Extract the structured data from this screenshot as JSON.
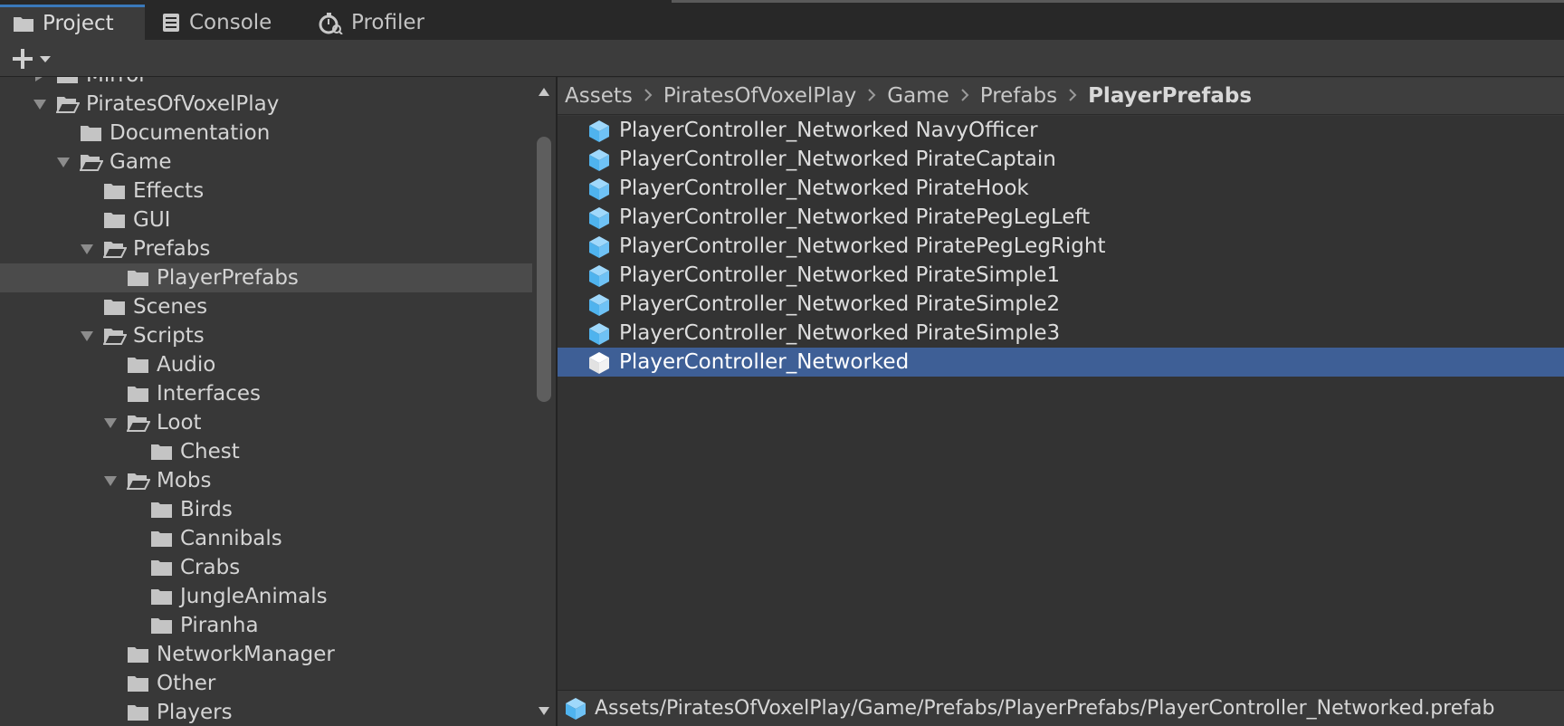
{
  "tabs": [
    {
      "label": "Project",
      "icon": "folder-icon",
      "active": true
    },
    {
      "label": "Console",
      "icon": "console-icon",
      "active": false
    },
    {
      "label": "Profiler",
      "icon": "profiler-icon",
      "active": false
    }
  ],
  "toolbar": {
    "create_icon": "plus-icon",
    "dropdown_icon": "chevron-down-icon"
  },
  "tree": [
    {
      "label": "Mirror",
      "depth": 1,
      "expanded": false,
      "has_children": true
    },
    {
      "label": "PiratesOfVoxelPlay",
      "depth": 1,
      "expanded": true,
      "has_children": true
    },
    {
      "label": "Documentation",
      "depth": 2,
      "expanded": false,
      "has_children": false
    },
    {
      "label": "Game",
      "depth": 2,
      "expanded": true,
      "has_children": true
    },
    {
      "label": "Effects",
      "depth": 3,
      "expanded": false,
      "has_children": false
    },
    {
      "label": "GUI",
      "depth": 3,
      "expanded": false,
      "has_children": false
    },
    {
      "label": "Prefabs",
      "depth": 3,
      "expanded": true,
      "has_children": true
    },
    {
      "label": "PlayerPrefabs",
      "depth": 4,
      "expanded": false,
      "has_children": false,
      "selected": true
    },
    {
      "label": "Scenes",
      "depth": 3,
      "expanded": false,
      "has_children": false
    },
    {
      "label": "Scripts",
      "depth": 3,
      "expanded": true,
      "has_children": true
    },
    {
      "label": "Audio",
      "depth": 4,
      "expanded": false,
      "has_children": false
    },
    {
      "label": "Interfaces",
      "depth": 4,
      "expanded": false,
      "has_children": false
    },
    {
      "label": "Loot",
      "depth": 4,
      "expanded": true,
      "has_children": true
    },
    {
      "label": "Chest",
      "depth": 5,
      "expanded": false,
      "has_children": false
    },
    {
      "label": "Mobs",
      "depth": 4,
      "expanded": true,
      "has_children": true
    },
    {
      "label": "Birds",
      "depth": 5,
      "expanded": false,
      "has_children": false
    },
    {
      "label": "Cannibals",
      "depth": 5,
      "expanded": false,
      "has_children": false
    },
    {
      "label": "Crabs",
      "depth": 5,
      "expanded": false,
      "has_children": false
    },
    {
      "label": "JungleAnimals",
      "depth": 5,
      "expanded": false,
      "has_children": false
    },
    {
      "label": "Piranha",
      "depth": 5,
      "expanded": false,
      "has_children": false
    },
    {
      "label": "NetworkManager",
      "depth": 4,
      "expanded": false,
      "has_children": false
    },
    {
      "label": "Other",
      "depth": 4,
      "expanded": false,
      "has_children": false
    },
    {
      "label": "Players",
      "depth": 4,
      "expanded": false,
      "has_children": false
    }
  ],
  "breadcrumb": [
    "Assets",
    "PiratesOfVoxelPlay",
    "Game",
    "Prefabs",
    "PlayerPrefabs"
  ],
  "files": [
    {
      "label": "PlayerController_Networked NavyOfficer",
      "icon": "prefab-variant-icon",
      "selected": false
    },
    {
      "label": "PlayerController_Networked PirateCaptain",
      "icon": "prefab-variant-icon",
      "selected": false
    },
    {
      "label": "PlayerController_Networked PirateHook",
      "icon": "prefab-variant-icon",
      "selected": false
    },
    {
      "label": "PlayerController_Networked PiratePegLegLeft",
      "icon": "prefab-variant-icon",
      "selected": false
    },
    {
      "label": "PlayerController_Networked PiratePegLegRight",
      "icon": "prefab-variant-icon",
      "selected": false
    },
    {
      "label": "PlayerController_Networked PirateSimple1",
      "icon": "prefab-variant-icon",
      "selected": false
    },
    {
      "label": "PlayerController_Networked PirateSimple2",
      "icon": "prefab-variant-icon",
      "selected": false
    },
    {
      "label": "PlayerController_Networked PirateSimple3",
      "icon": "prefab-variant-icon",
      "selected": false
    },
    {
      "label": "PlayerController_Networked",
      "icon": "prefab-icon",
      "selected": true
    }
  ],
  "status": {
    "path": "Assets/PiratesOfVoxelPlay/Game/Prefabs/PlayerPrefabs/PlayerController_Networked.prefab",
    "icon": "prefab-icon"
  },
  "colors": {
    "selection": "#3e5f96",
    "tree_selection": "#4b4b4b",
    "prefab_blue": "#6fc2f5",
    "background": "#383838"
  }
}
